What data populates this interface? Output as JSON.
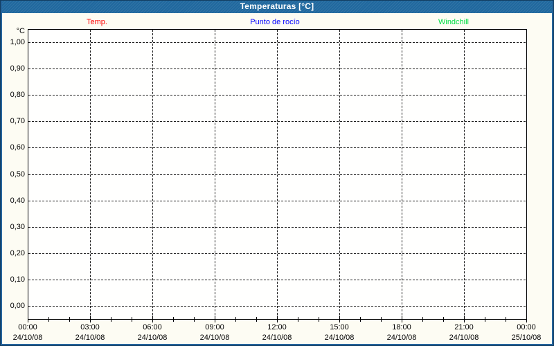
{
  "window": {
    "title": "Temperaturas [°C]"
  },
  "legend": {
    "items": [
      {
        "label": "Temp.",
        "color": "#ff0000"
      },
      {
        "label": "Punto de rocío",
        "color": "#0000ff"
      },
      {
        "label": "Windchill",
        "color": "#00dd44"
      }
    ]
  },
  "chart_data": {
    "type": "line",
    "title": "Temperaturas [°C]",
    "ylabel": "°C",
    "ylim": [
      0.0,
      1.0
    ],
    "y_tick_step": 0.1,
    "y_tick_labels_top_to_bottom": [
      "1,00",
      "0,90",
      "0,80",
      "0,70",
      "0,60",
      "0,50",
      "0,40",
      "0,30",
      "0,20",
      "0,10",
      "0,00"
    ],
    "x_axis": {
      "tick_times": [
        "00:00",
        "03:00",
        "06:00",
        "09:00",
        "12:00",
        "15:00",
        "18:00",
        "21:00",
        "00:00"
      ],
      "tick_dates": [
        "24/10/08",
        "24/10/08",
        "24/10/08",
        "24/10/08",
        "24/10/08",
        "24/10/08",
        "24/10/08",
        "24/10/08",
        "25/10/08"
      ],
      "major_tick_interval_hours": 3,
      "minor_tick_interval_hours": 1
    },
    "grid": "dashed-both-axes",
    "legend_position": "top",
    "series": [
      {
        "name": "Temp.",
        "color": "#ff0000",
        "x": [],
        "values": []
      },
      {
        "name": "Punto de rocío",
        "color": "#0000ff",
        "x": [],
        "values": []
      },
      {
        "name": "Windchill",
        "color": "#00dd44",
        "x": [],
        "values": []
      }
    ]
  }
}
